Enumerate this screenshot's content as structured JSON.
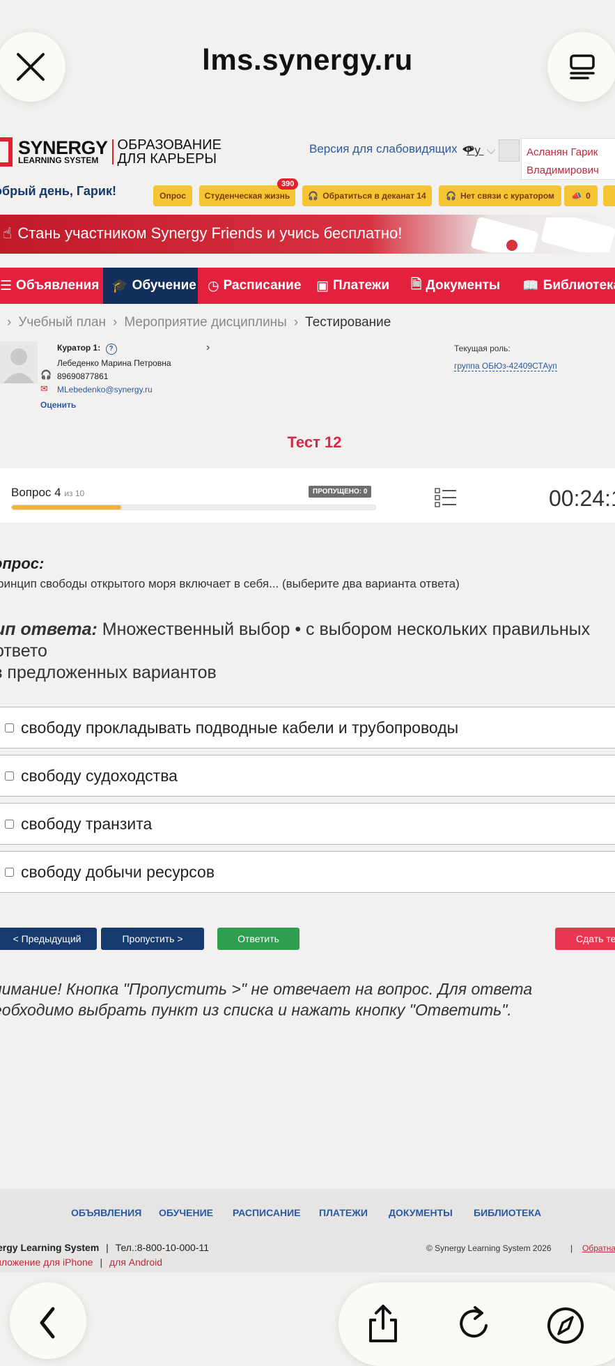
{
  "browser": {
    "url": "lms.synergy.ru"
  },
  "header": {
    "logo_main": "SYNERGY",
    "logo_sub": "LEARNING SYSTEM",
    "logo_right_1": "ОБРАЗОВАНИЕ",
    "logo_right_2": "ДЛЯ КАРЬЕРЫ",
    "accessibility": "Версия для слабовидящих",
    "language": "Ру",
    "user_name_1": "Асланян Гарик",
    "user_name_2": "Владимирович",
    "greeting": "обрый день, Гарик!"
  },
  "chips": {
    "survey": "Опрос",
    "student_life": "Студенческая жизнь",
    "student_life_badge": "390",
    "dean": "Обратиться в деканат 14",
    "curator": "Нет связи с куратором",
    "ann_count": "0"
  },
  "banner": {
    "text": "Стань участником Synergy Friends и учись бесплатно!"
  },
  "nav": {
    "announcements": "Объявления",
    "study": "Обучение",
    "schedule": "Расписание",
    "payments": "Платежи",
    "documents": "Документы",
    "library": "Библиотека"
  },
  "breadcrumb": {
    "plan": "Учебный план",
    "event": "Мероприятие дисциплины",
    "current": "Тестирование"
  },
  "curator": {
    "label": "Куратор 1:",
    "name": "Лебеденко Марина Петровна",
    "phone": "89690877861",
    "email": "MLebedenko@synergy.ru",
    "rate": "Оценить",
    "role_label": "Текущая роль:",
    "role_value": "группа ОБЮз-42409СТАуп"
  },
  "test": {
    "title": "Тест 12",
    "question_label": "Вопрос 4",
    "question_of": "из 10",
    "skipped": "ПРОПУЩЕНО: 0",
    "progress": 0.3,
    "timer": "00:24:1"
  },
  "question": {
    "head": "опрос:",
    "text": "ринцип свободы открытого моря включает в себя... (выберите два варианта ответа)",
    "type_label": "ип ответа:",
    "type_text": " Множественный выбор • с выбором нескольких правильных ответо",
    "type_text_2": "з предложенных вариантов",
    "options": [
      "свободу прокладывать подводные кабели и трубопроводы",
      "свободу судоходства",
      "свободу транзита",
      "свободу добычи ресурсов"
    ]
  },
  "buttons": {
    "prev": "< Предыдущий",
    "skip": "Пропустить >",
    "answer": "Ответить",
    "submit": "Сдать тес"
  },
  "warning": {
    "line1": "нимание! Кнопка \"Пропустить >\" не отвечает на вопрос. Для ответа",
    "line2": "еобходимо выбрать пункт из списка и нажать кнопку \"Ответить\"."
  },
  "footer": {
    "nav": [
      "ОБЪЯВЛЕНИЯ",
      "ОБУЧЕНИЕ",
      "РАСПИСАНИЕ",
      "ПЛАТЕЖИ",
      "ДОКУМЕНТЫ",
      "БИБЛИОТЕКА"
    ],
    "company": "ergy Learning System",
    "phone": "Тел.:8-800-10-000-11",
    "app_iphone": "иложение для iPhone",
    "app_android": "для Android",
    "copyright": "© Synergy Learning System 2026",
    "link": "Обратна"
  },
  "colors": {
    "brand_red": "#e3203e",
    "nav_active": "#132f5c",
    "chip_yellow": "#f6c332",
    "answer_green": "#2f9e4f",
    "button_navy": "#163a6e"
  }
}
